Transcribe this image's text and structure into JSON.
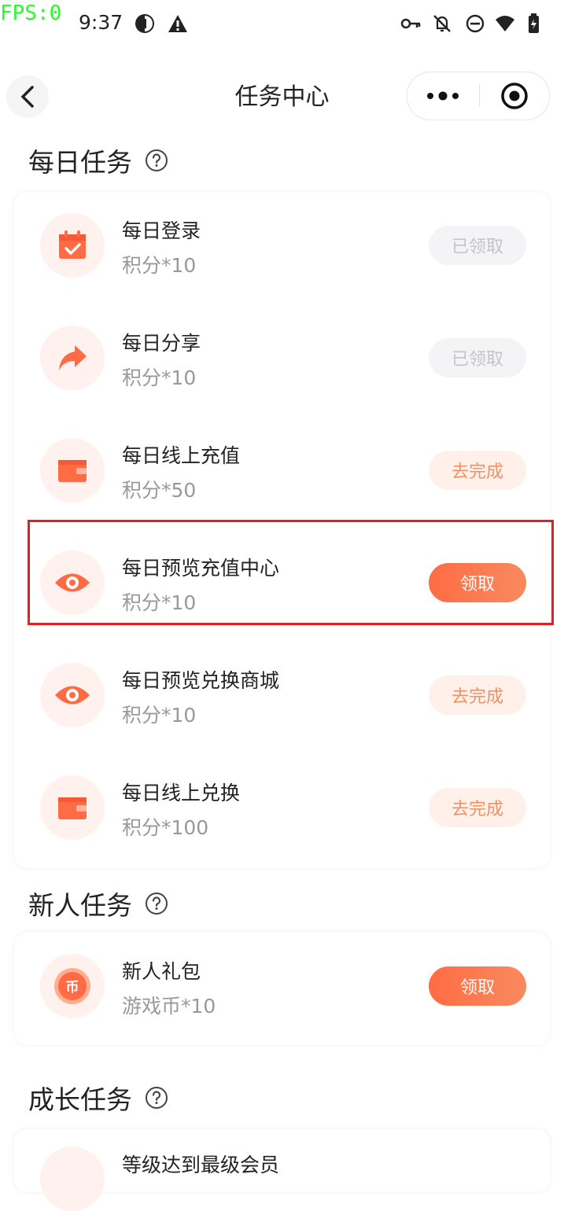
{
  "debug": {
    "fps": "FPS:0"
  },
  "status_bar": {
    "time": "9:37"
  },
  "nav": {
    "title": "任务中心"
  },
  "sections": {
    "daily": {
      "title": "每日任务"
    },
    "newbie": {
      "title": "新人任务"
    },
    "growth": {
      "title": "成长任务"
    }
  },
  "daily_tasks": [
    {
      "name": "每日登录",
      "reward": "积分*10",
      "button": "已领取",
      "state": "claimed",
      "icon": "calendar-check-icon"
    },
    {
      "name": "每日分享",
      "reward": "积分*10",
      "button": "已领取",
      "state": "claimed",
      "icon": "share-arrow-icon"
    },
    {
      "name": "每日线上充值",
      "reward": "积分*50",
      "button": "去完成",
      "state": "todo",
      "icon": "wallet-icon"
    },
    {
      "name": "每日预览充值中心",
      "reward": "积分*10",
      "button": "领取",
      "state": "claimable",
      "icon": "eye-icon"
    },
    {
      "name": "每日预览兑换商城",
      "reward": "积分*10",
      "button": "去完成",
      "state": "todo",
      "icon": "eye-icon"
    },
    {
      "name": "每日线上兑换",
      "reward": "积分*100",
      "button": "去完成",
      "state": "todo",
      "icon": "wallet-icon"
    }
  ],
  "newbie_tasks": [
    {
      "name": "新人礼包",
      "reward": "游戏币*10",
      "button": "领取",
      "state": "claimable",
      "icon": "coin-icon",
      "coin_glyph": "币"
    }
  ],
  "growth_tasks": [
    {
      "name": "等级达到最级会员",
      "state": "partial"
    }
  ],
  "colors": {
    "accent": "#ff6c44",
    "icon_bg": "#fff1ee",
    "highlight": "#e02020"
  }
}
